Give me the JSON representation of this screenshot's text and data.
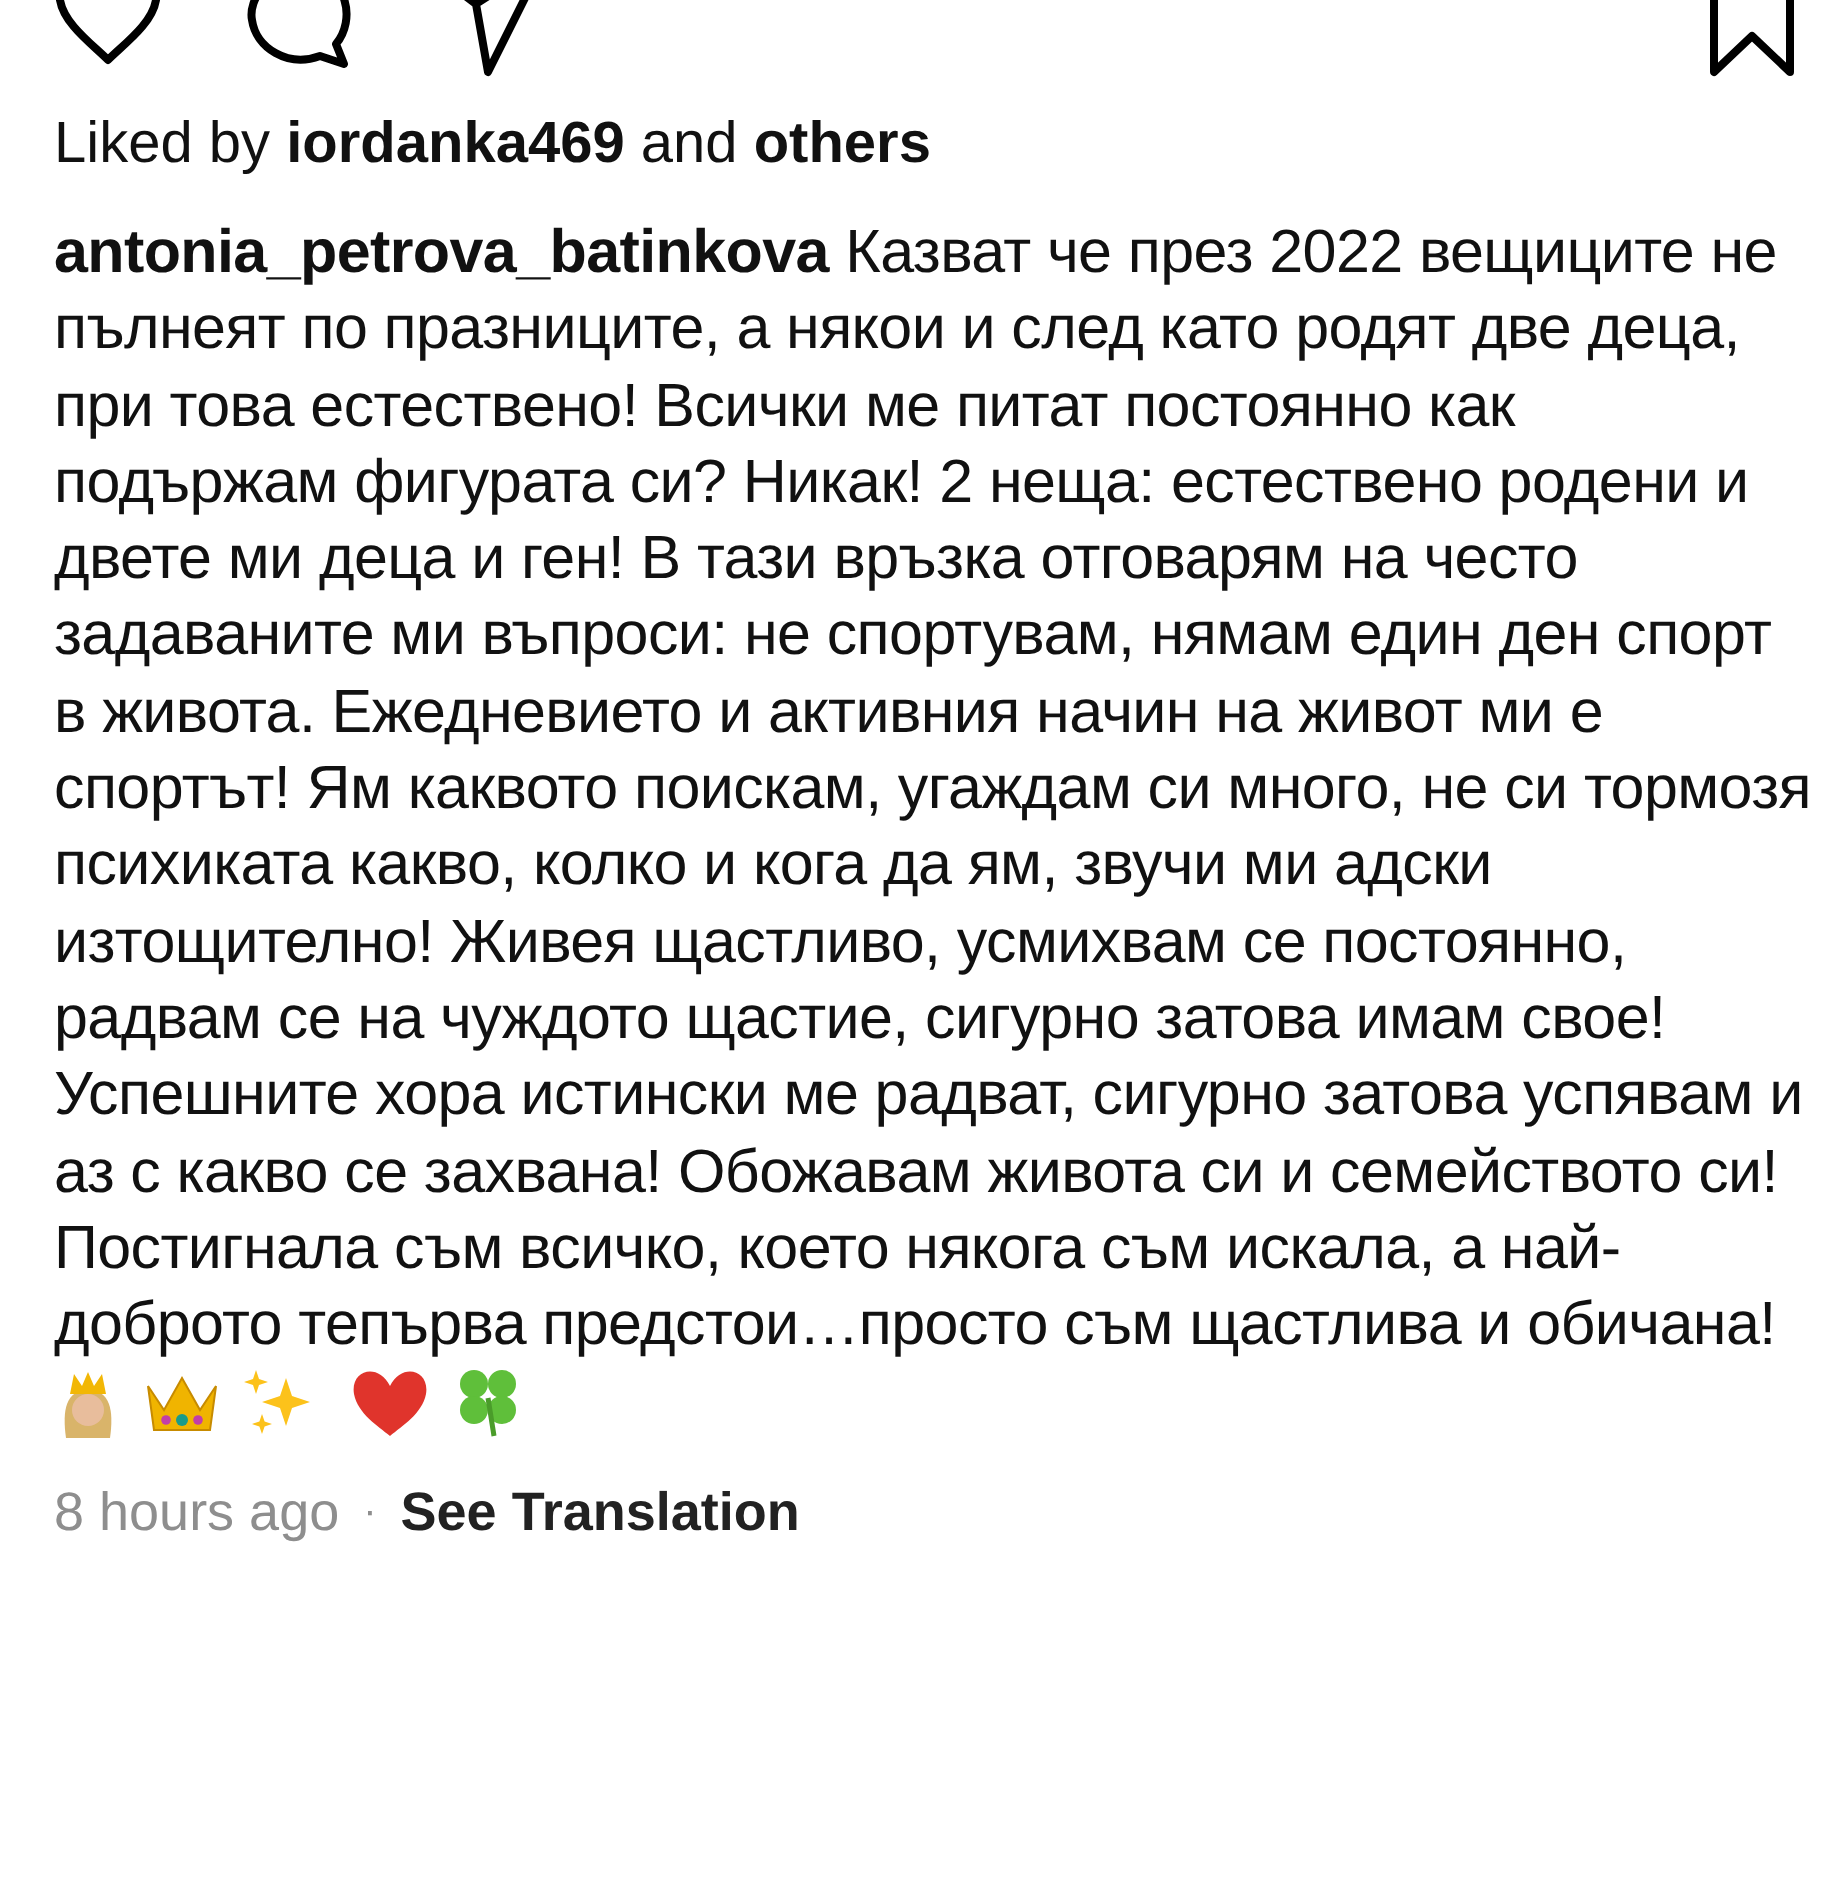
{
  "likes": {
    "text": "Liked by **iordanka469** and **others**"
  },
  "caption": {
    "text": "**antonia_petrova_batinkova** Казват че през 2022 вещиците не пълнеят по празниците, а някои и след като родят две деца, при това естествено! Всички ме питат постоянно как подържам фигурата си? Никак! 2 неща: естествено родени и двете ми деца и ген! В тази връзка отговарям на често задаваните ми въпроси: не спортувам, нямам един ден спорт в живота. Ежедневието и активния начин на живот ми е спортът! Ям каквото поискам, угаждам си много, не си тормозя психиката какво, колко и кога да ям, звучи ми адски изтощително! Живея щастливо, усмихвам се постоянно, радвам се на чуждото щастие, сигурно затова имам свое! Успешните хора истински ме радват, сигурно затова успявам и аз с какво се захвана! Обожавам живота си и семейството си! Постигнала съм всичко, което някога съм искала, а най-доброто тепърва предстои…просто съм щастлива и обичана!"
  },
  "footer": {
    "time": "8 hours ago",
    "separator": "·",
    "translate": "See Translation"
  }
}
